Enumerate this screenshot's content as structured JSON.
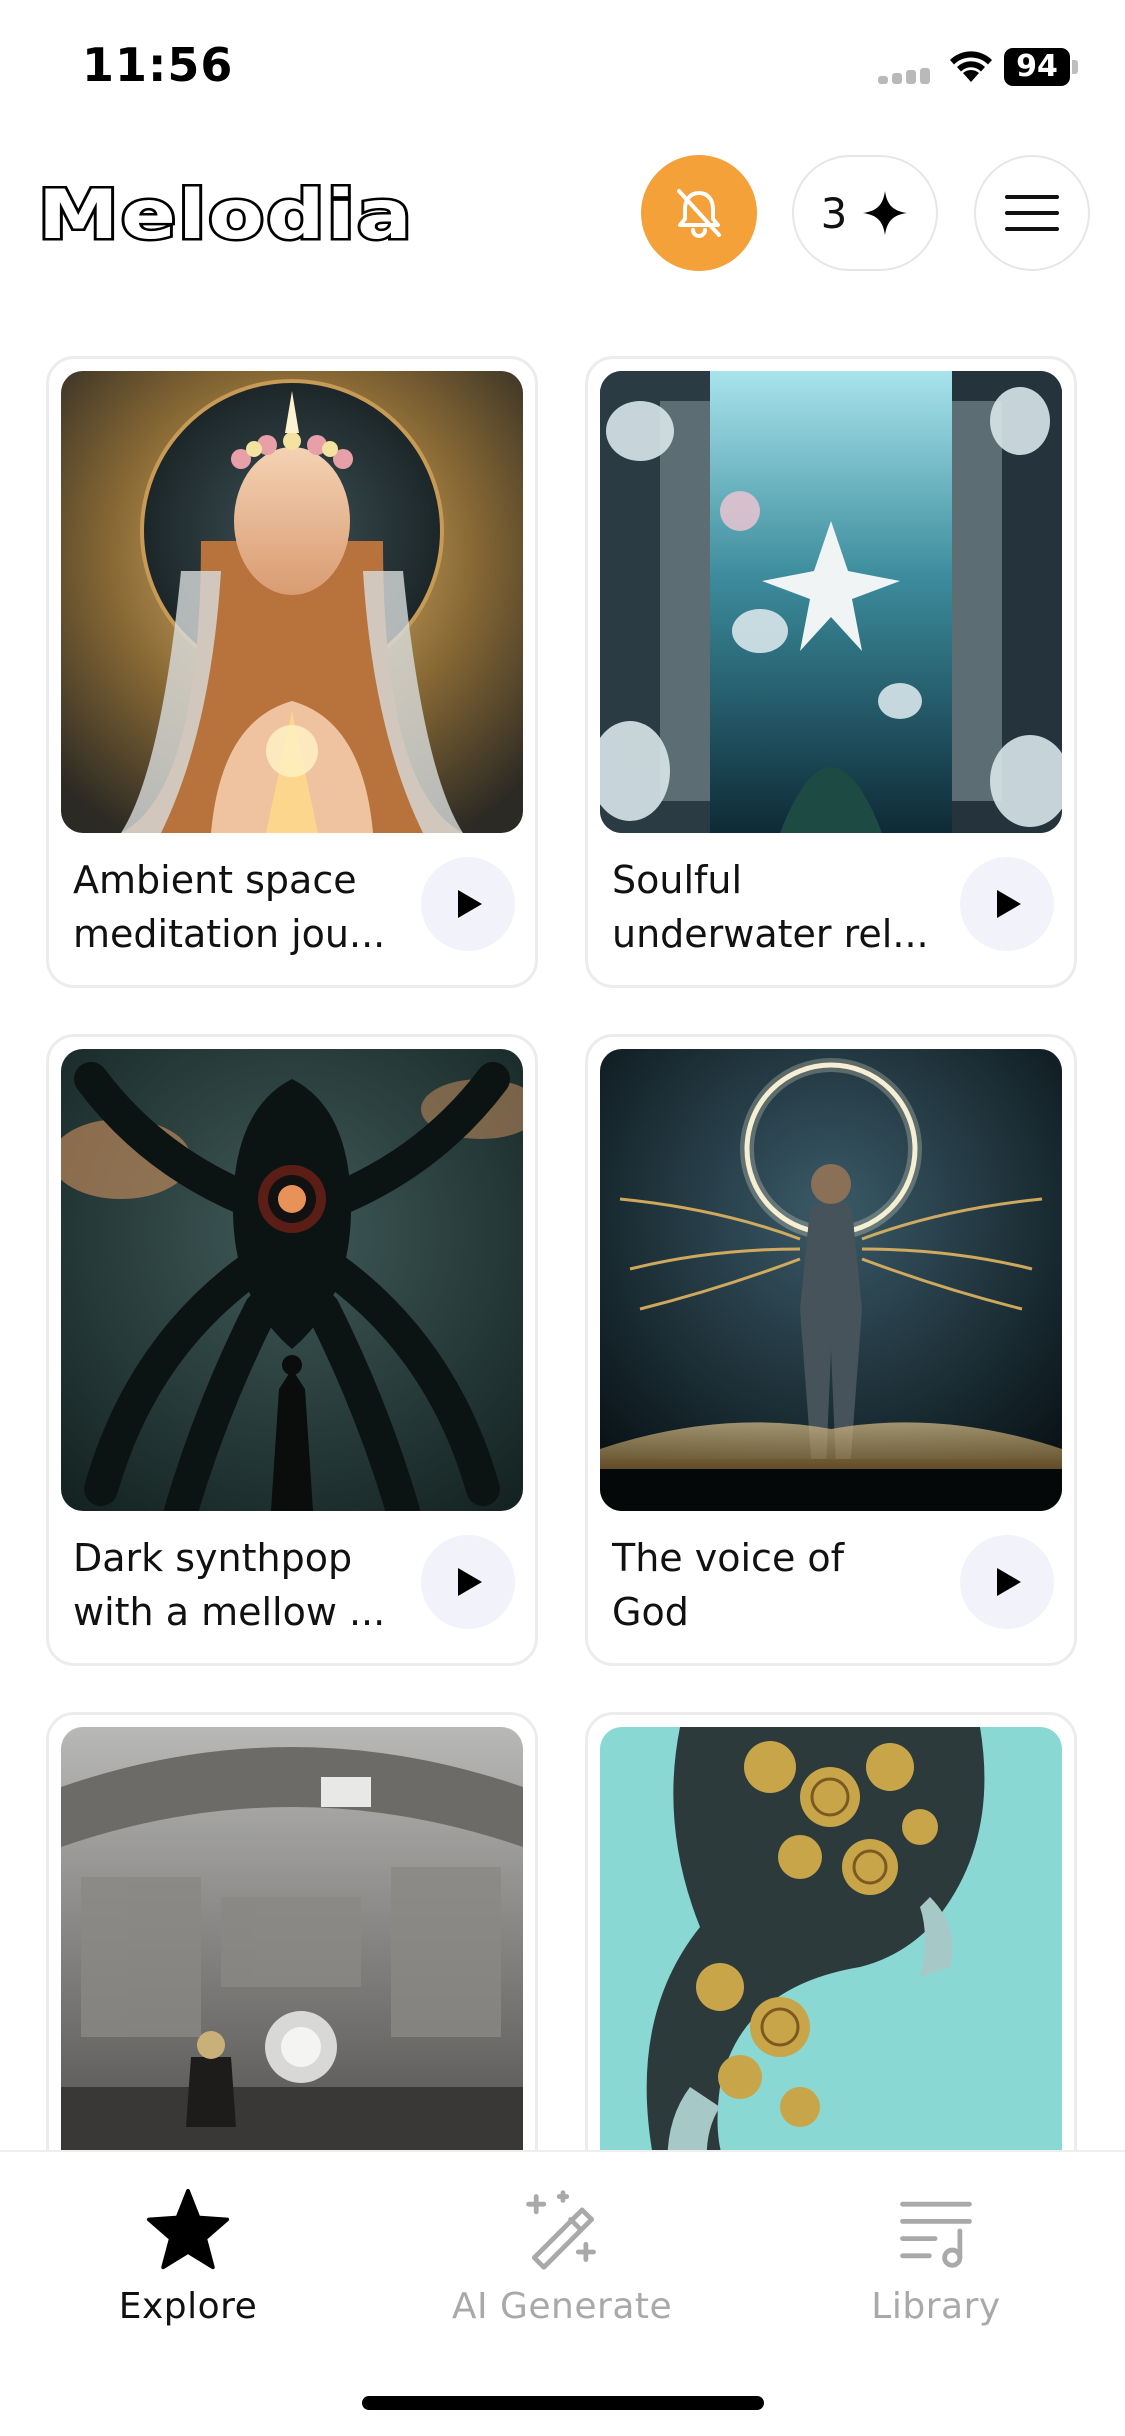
{
  "status_bar": {
    "time": "11:56",
    "battery": "94"
  },
  "header": {
    "logo_text": "Melodia",
    "credits_count": "3",
    "accent_color": "#f4a13a"
  },
  "cards": [
    {
      "title_line1": "Ambient space",
      "title_line2": "meditation jou...",
      "art": "haloed-woman-praying"
    },
    {
      "title_line1": "Soulful",
      "title_line2": "underwater rel...",
      "art": "underwater-flower-doorway"
    },
    {
      "title_line1": "Dark synthpop",
      "title_line2": "with a mellow ...",
      "art": "giant-cephalopod-figure"
    },
    {
      "title_line1": "The voice of",
      "title_line2": "God",
      "art": "radiant-winged-figure"
    },
    {
      "title_line1": "",
      "title_line2": "",
      "art": "industrial-control-room"
    },
    {
      "title_line1": "",
      "title_line2": "",
      "art": "clockwork-heads-cyan"
    }
  ],
  "tabs": [
    {
      "label": "Explore",
      "icon": "star-icon",
      "active": true
    },
    {
      "label": "AI Generate",
      "icon": "magic-wand-icon",
      "active": false
    },
    {
      "label": "Library",
      "icon": "music-list-icon",
      "active": false
    }
  ]
}
